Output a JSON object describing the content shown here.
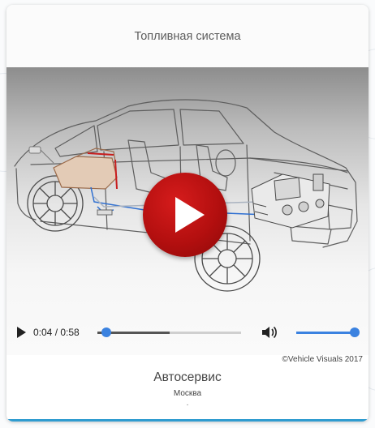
{
  "card": {
    "title": "Топливная система"
  },
  "media": {
    "illustration": "car-fuel-system-cutaway",
    "play_overlay_icon": "play-icon",
    "accent_color": "#b30f0f"
  },
  "player": {
    "play_icon": "play-icon",
    "time_display": "0:04 / 0:58",
    "progress_fraction": 0.06,
    "buffered_fraction": 0.5,
    "volume_icon": "speaker-icon",
    "volume_fraction": 1.0,
    "accent_color": "#3b82e0"
  },
  "copyright": "©Vehicle Visuals 2017",
  "organization": {
    "name": "Автосервис",
    "city": "Москва",
    "extra": "."
  },
  "colors": {
    "bottom_accent": "#2f9cd0"
  }
}
